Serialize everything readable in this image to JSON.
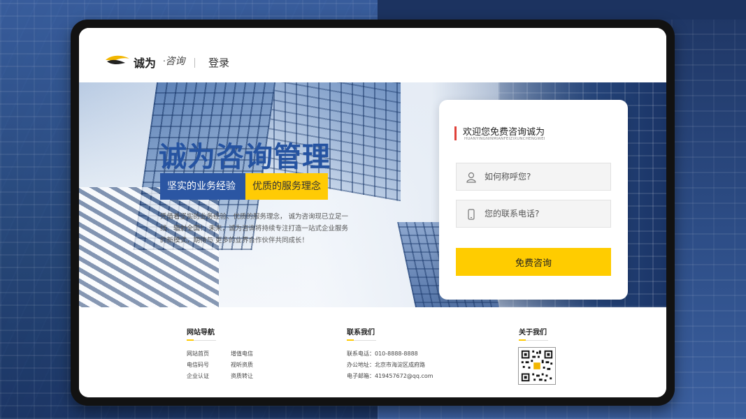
{
  "header": {
    "logo_text": "诚为",
    "logo_sub": "·咨询",
    "login_label": "登录"
  },
  "hero": {
    "title": "诚为咨询管理",
    "tag_blue": "坚实的业务经验",
    "tag_yellow": "优质的服务理念",
    "description": "凭借着坚实的业务经验、优质的服务理念， 诚为咨询现已立足一线、辐射全国！ 未来，诚为咨询将持续专注打造一站式企业服务的新模式，期待与 更多的业界合作伙伴共同成长！"
  },
  "form": {
    "title": "欢迎您免费咨询诚为",
    "subtitle": "HUANYINGNINMIANFEIZIXUNCHENGWEI",
    "name_placeholder": "如何称呼您?",
    "phone_placeholder": "您的联系电话?",
    "submit_label": "免费咨询"
  },
  "footer": {
    "nav_title": "网站导航",
    "nav_links": [
      "网站首页",
      "增值电信",
      "电信码号",
      "视听资质",
      "企业认证",
      "资质转让"
    ],
    "contact_title": "联系我们",
    "contact_lines": [
      "联系电话：010-8888-8888",
      "办公地址：北京市海淀区成府路",
      "电子邮箱：419457672@qq.com"
    ],
    "about_title": "关于我们"
  },
  "colors": {
    "brand_blue": "#2b56a3",
    "brand_yellow": "#ffcb05",
    "accent_red": "#e0413a"
  }
}
